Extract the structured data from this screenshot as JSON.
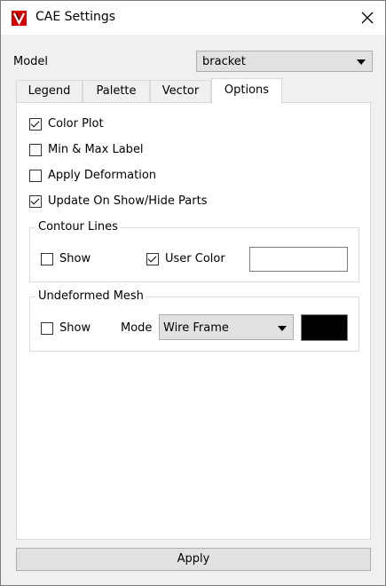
{
  "window": {
    "title": "CAE Settings"
  },
  "model": {
    "label": "Model",
    "value": "bracket"
  },
  "tabs": [
    {
      "label": "Legend",
      "active": false
    },
    {
      "label": "Palette",
      "active": false
    },
    {
      "label": "Vector",
      "active": false
    },
    {
      "label": "Options",
      "active": true
    }
  ],
  "options": {
    "color_plot": {
      "label": "Color Plot",
      "checked": true
    },
    "min_max_label": {
      "label": "Min & Max Label",
      "checked": false
    },
    "apply_deformation": {
      "label": "Apply Deformation",
      "checked": false
    },
    "update_on_show_hide": {
      "label": "Update On Show/Hide Parts",
      "checked": true
    }
  },
  "contour_lines": {
    "title": "Contour Lines",
    "show": {
      "label": "Show",
      "checked": false
    },
    "user_color": {
      "label": "User Color",
      "checked": true
    },
    "color": "#ffffff"
  },
  "undeformed_mesh": {
    "title": "Undeformed Mesh",
    "show": {
      "label": "Show",
      "checked": false
    },
    "mode_label": "Mode",
    "mode_value": "Wire Frame",
    "color": "#000000"
  },
  "apply_button": {
    "label": "Apply"
  },
  "icons": {
    "app": "app-logo-icon",
    "close": "close-icon"
  }
}
